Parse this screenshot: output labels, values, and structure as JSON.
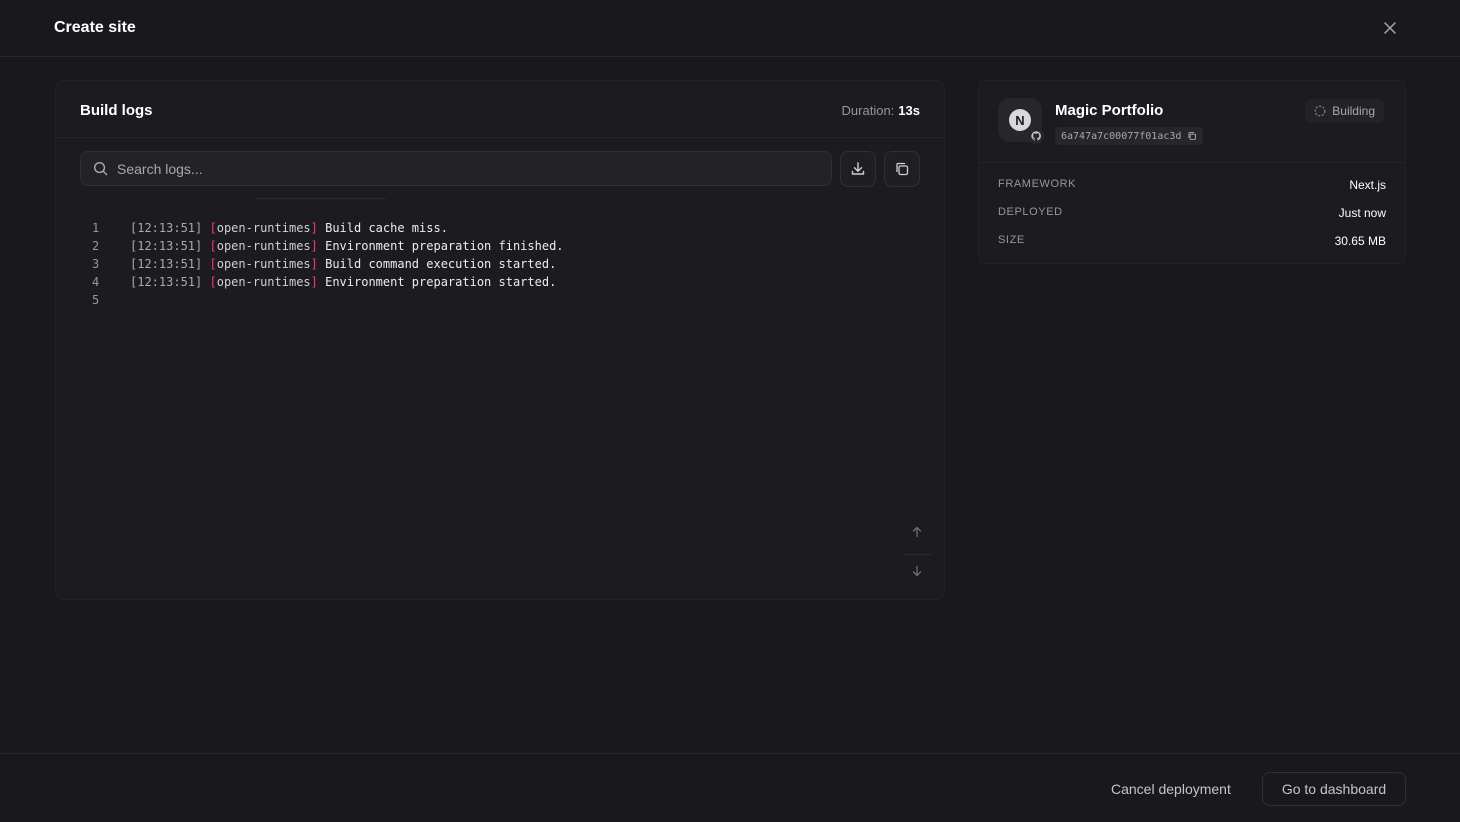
{
  "header": {
    "title": "Create site"
  },
  "logs": {
    "title": "Build logs",
    "duration_label": "Duration:",
    "duration_value": "13s",
    "search_placeholder": "Search logs...",
    "lines": [
      {
        "num": "1",
        "time": "[12:13:51]",
        "source": "open-runtimes",
        "message": "Build cache miss."
      },
      {
        "num": "2",
        "time": "[12:13:51]",
        "source": "open-runtimes",
        "message": "Environment preparation finished."
      },
      {
        "num": "3",
        "time": "[12:13:51]",
        "source": "open-runtimes",
        "message": "Build command execution started."
      },
      {
        "num": "4",
        "time": "[12:13:51]",
        "source": "open-runtimes",
        "message": "Environment preparation started."
      },
      {
        "num": "5",
        "time": "",
        "source": "",
        "message": ""
      }
    ]
  },
  "site": {
    "name": "Magic Portfolio",
    "avatar_letter": "N",
    "commit": "6a747a7c00077f01ac3d",
    "status": "Building",
    "details": [
      {
        "key": "FRAMEWORK",
        "value": "Next.js"
      },
      {
        "key": "DEPLOYED",
        "value": "Just now"
      },
      {
        "key": "SIZE",
        "value": "30.65 MB"
      }
    ]
  },
  "footer": {
    "cancel_label": "Cancel deployment",
    "dashboard_label": "Go to dashboard"
  },
  "colors": {
    "accent": "#fd366e",
    "background": "#19191d"
  }
}
